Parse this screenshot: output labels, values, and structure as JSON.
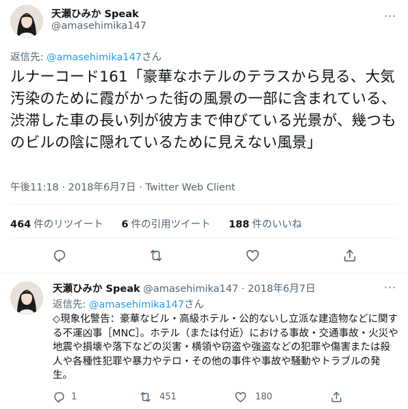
{
  "colors": {
    "link": "#1d9bf0",
    "muted": "#536471",
    "text": "#0f1419",
    "divider": "#eff3f4"
  },
  "tweet": {
    "display_name": "天瀬ひみか Speak",
    "handle": "@amasehimika147",
    "more_icon": "ellipsis-icon",
    "reply_prefix": "返信先: ",
    "reply_handle": "@amasehimika147",
    "reply_suffix": "さん",
    "text": "ルナーコード161「豪華なホテルのテラスから見る、大気汚染のために霞がかった街の風景の一部に含まれている、渋滞した車の長い列が彼方まで伸びている光景が、幾つものビルの陰に隠れているために見えない風景」",
    "time": "午後11:18",
    "sep1": "·",
    "date": "2018年6月7日",
    "sep2": "·",
    "client": "Twitter Web Client",
    "stats": {
      "retweets_num": "464",
      "retweets_label": "件のリツイート",
      "quotes_num": "6",
      "quotes_label": "件の引用ツイート",
      "likes_num": "188",
      "likes_label": "件のいいね"
    },
    "actions": [
      "reply-icon",
      "retweet-icon",
      "like-icon",
      "share-icon"
    ]
  },
  "reply_tweet": {
    "display_name": "天瀬ひみか Speak",
    "handle": "@amasehimika147",
    "sep": "·",
    "date": "2018年6月7日",
    "more_icon": "ellipsis-icon",
    "reply_prefix": "返信先: ",
    "reply_handle": "@amasehimika147",
    "reply_suffix": "さん",
    "text": "◇現象化警告：豪華なビル・高級ホテル・公的ないし立派な建造物などに関する不運凶事［MNC］。ホテル（または付近）における事故・交通事故・火災や地震や損壊や落下などの災害・横領や窃盗や強盗などの犯罪や傷害または殺人や各種性犯罪や暴力やテロ・その他の事件や事故や騒動やトラブルの発生。",
    "reply_count": "1",
    "retweet_count": "451",
    "like_count": "180"
  }
}
